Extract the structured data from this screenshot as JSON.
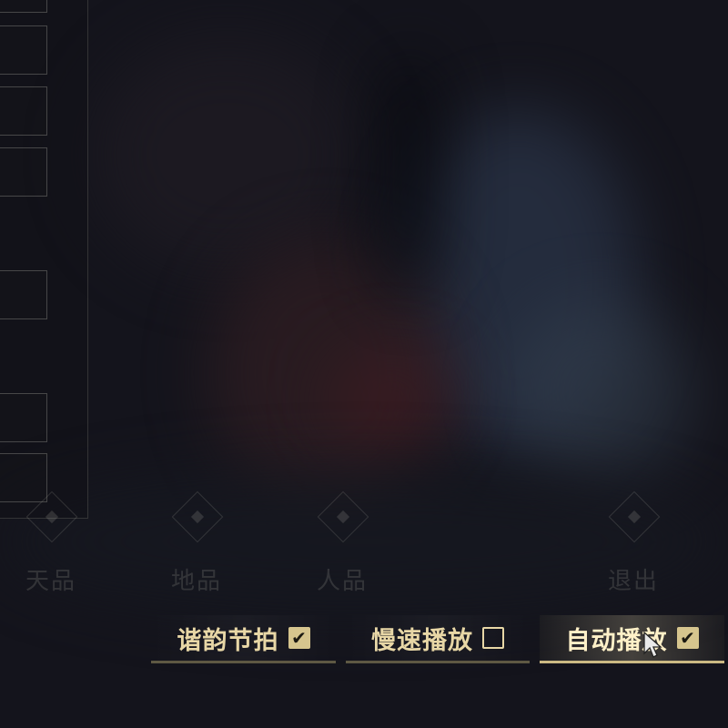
{
  "menu": {
    "items": [
      {
        "label": "天品",
        "icon": "diamond-icon"
      },
      {
        "label": "地品",
        "icon": "diamond-icon"
      },
      {
        "label": "人品",
        "icon": "diamond-icon"
      },
      {
        "label": "退出",
        "icon": "diamond-icon"
      }
    ]
  },
  "toggles": [
    {
      "label": "谐韵节拍",
      "checked": true,
      "mark": "✔"
    },
    {
      "label": "慢速播放",
      "checked": false,
      "mark": ""
    },
    {
      "label": "自动播放",
      "checked": true,
      "mark": "✔"
    }
  ],
  "colors": {
    "gold_text": "#e8d7a6",
    "gold_underline": "#cbb983",
    "background": "#14141c"
  }
}
